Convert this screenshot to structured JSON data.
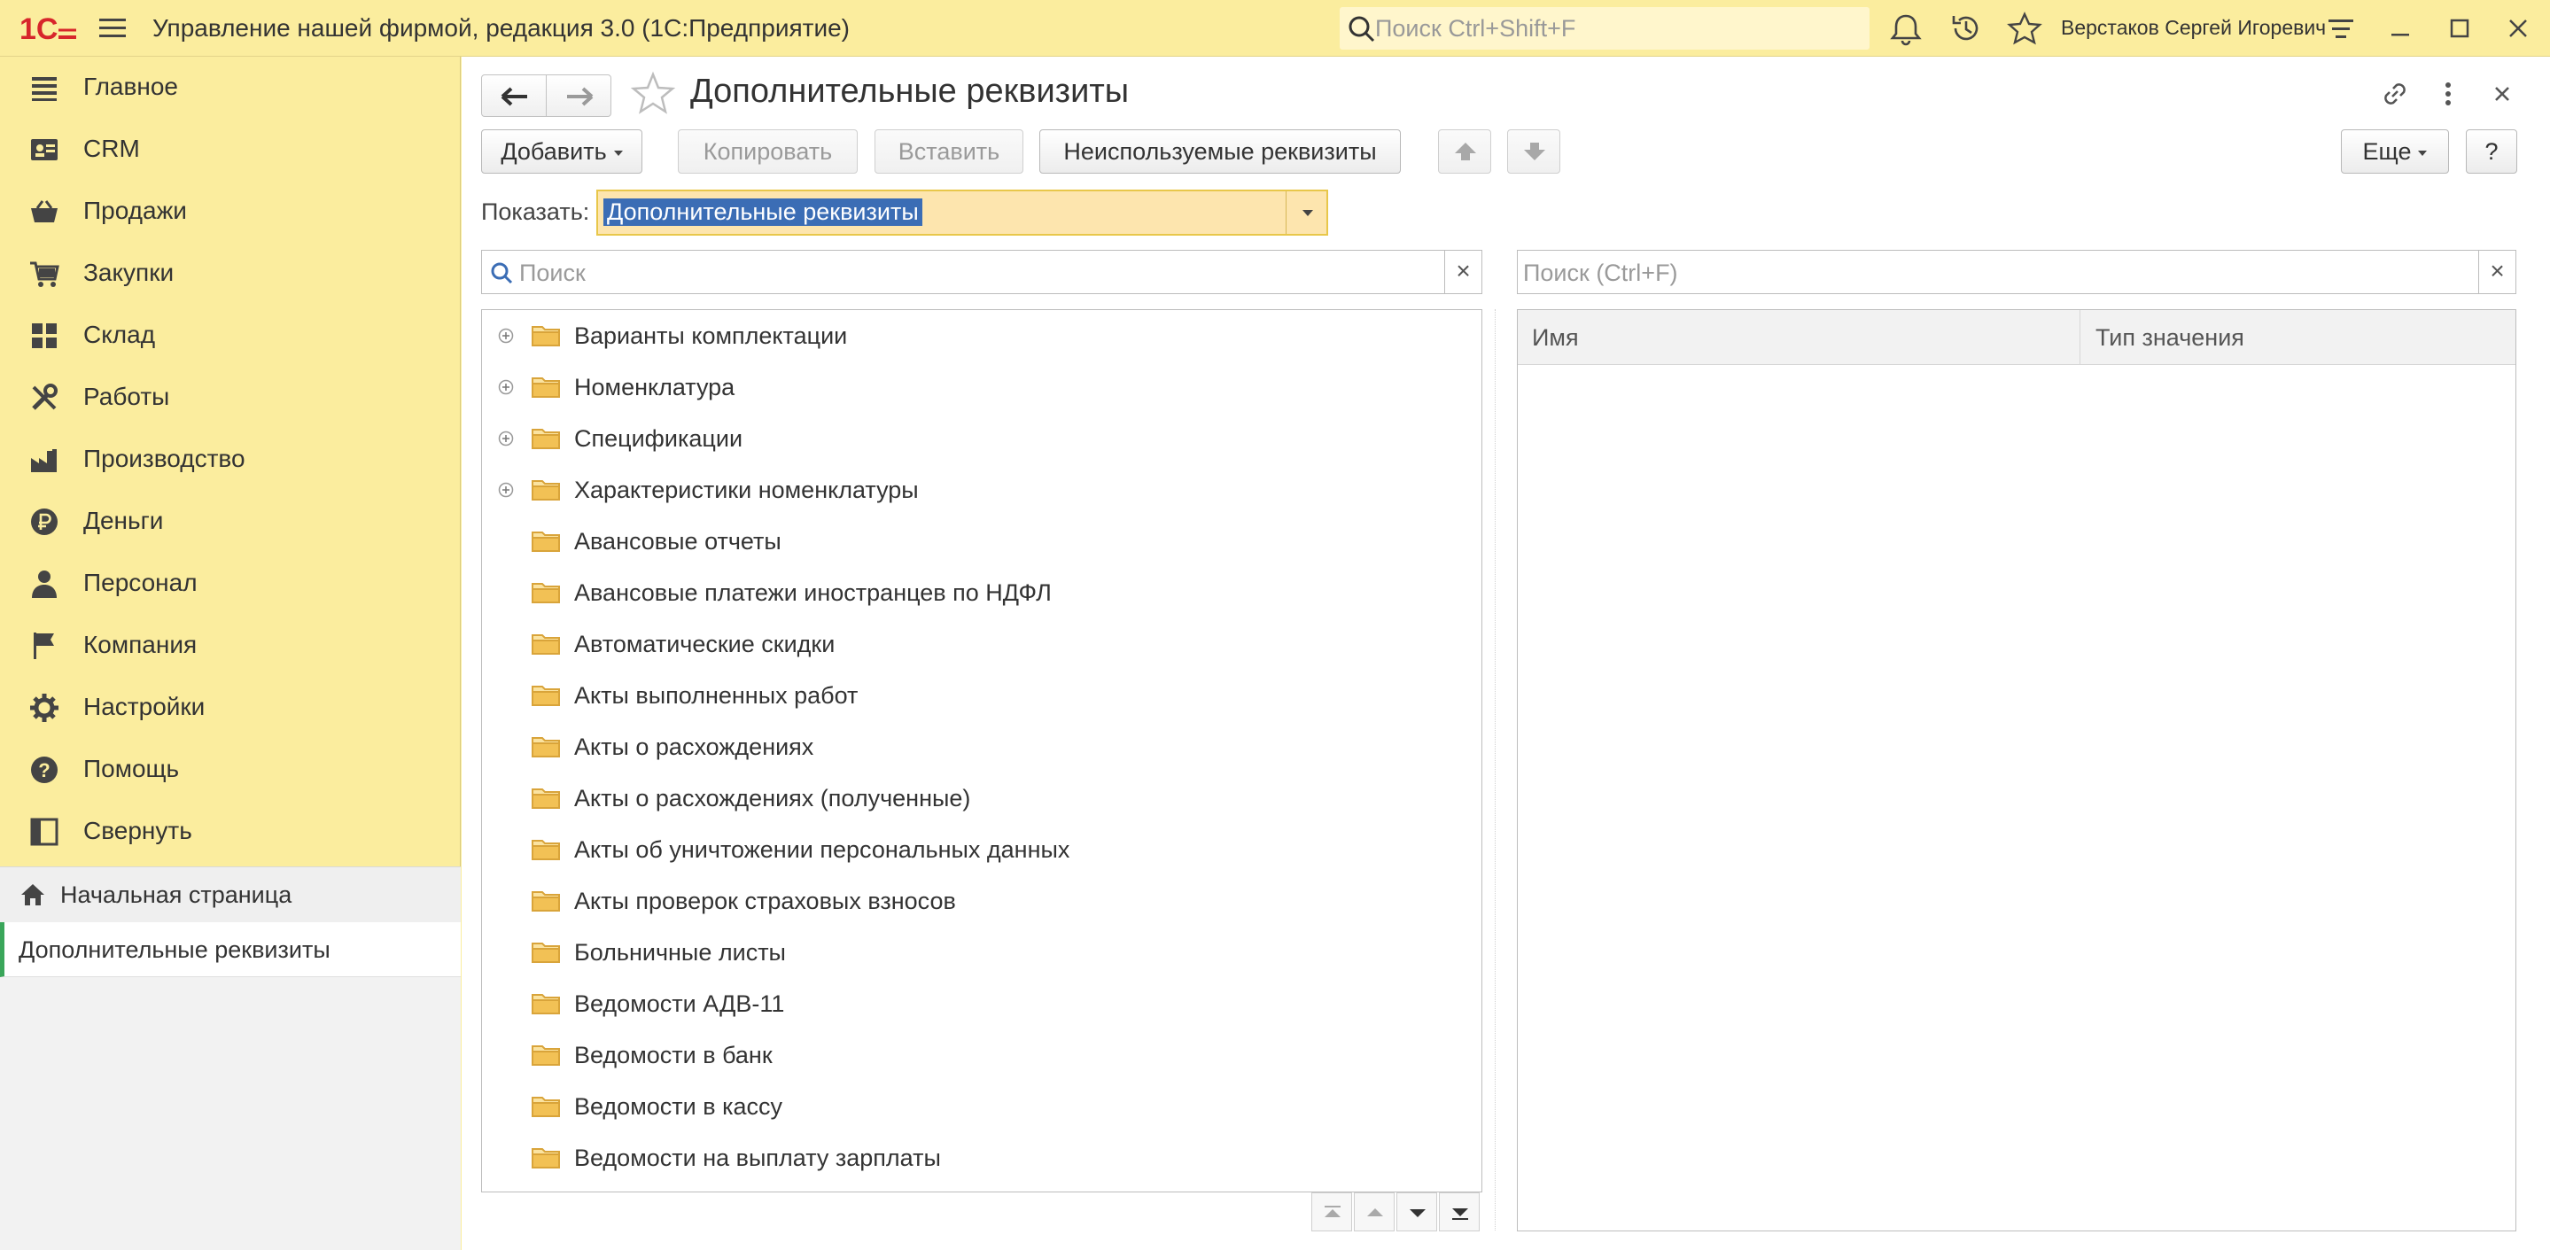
{
  "titlebar": {
    "app_title": "Управление нашей фирмой, редакция 3.0  (1С:Предприятие)",
    "search_placeholder": "Поиск Ctrl+Shift+F",
    "user_name": "Верстаков Сергей Игоревич"
  },
  "sidebar": {
    "items": [
      {
        "label": "Главное",
        "icon": "menu-lines-icon"
      },
      {
        "label": "CRM",
        "icon": "contacts-icon"
      },
      {
        "label": "Продажи",
        "icon": "basket-icon"
      },
      {
        "label": "Закупки",
        "icon": "cart-icon"
      },
      {
        "label": "Склад",
        "icon": "grid-icon"
      },
      {
        "label": "Работы",
        "icon": "tools-icon"
      },
      {
        "label": "Производство",
        "icon": "factory-icon"
      },
      {
        "label": "Деньги",
        "icon": "ruble-icon"
      },
      {
        "label": "Персонал",
        "icon": "person-icon"
      },
      {
        "label": "Компания",
        "icon": "flag-icon"
      },
      {
        "label": "Настройки",
        "icon": "gear-icon"
      },
      {
        "label": "Помощь",
        "icon": "help-icon"
      },
      {
        "label": "Свернуть",
        "icon": "collapse-icon"
      }
    ],
    "open_windows": {
      "home": "Начальная страница",
      "active": "Дополнительные реквизиты"
    }
  },
  "form": {
    "title": "Дополнительные реквизиты",
    "toolbar": {
      "add": "Добавить",
      "copy": "Копировать",
      "paste": "Вставить",
      "unused": "Неиспользуемые реквизиты",
      "more": "Еще",
      "help": "?"
    },
    "show_label": "Показать:",
    "show_value": "Дополнительные реквизиты",
    "left_search_placeholder": "Поиск",
    "right_search_placeholder": "Поиск (Ctrl+F)",
    "clear_symbol": "×",
    "tree": [
      {
        "label": "Варианты комплектации",
        "expandable": true
      },
      {
        "label": "Номенклатура",
        "expandable": true
      },
      {
        "label": "Спецификации",
        "expandable": true
      },
      {
        "label": "Характеристики номенклатуры",
        "expandable": true
      },
      {
        "label": "Авансовые отчеты",
        "expandable": false
      },
      {
        "label": "Авансовые платежи иностранцев по НДФЛ",
        "expandable": false
      },
      {
        "label": "Автоматические скидки",
        "expandable": false
      },
      {
        "label": "Акты выполненных работ",
        "expandable": false
      },
      {
        "label": "Акты о расхождениях",
        "expandable": false
      },
      {
        "label": "Акты о расхождениях (полученные)",
        "expandable": false
      },
      {
        "label": "Акты об уничтожении персональных данных",
        "expandable": false
      },
      {
        "label": "Акты проверок страховых взносов",
        "expandable": false
      },
      {
        "label": "Больничные листы",
        "expandable": false
      },
      {
        "label": "Ведомости АДВ-11",
        "expandable": false
      },
      {
        "label": "Ведомости в банк",
        "expandable": false
      },
      {
        "label": "Ведомости в кассу",
        "expandable": false
      },
      {
        "label": "Ведомости на выплату зарплаты",
        "expandable": false
      }
    ],
    "list_columns": [
      "Имя",
      "Тип значения"
    ]
  },
  "colors": {
    "panel_yellow": "#fbed9e",
    "active_green": "#3aa65a",
    "selection_blue": "#3b6db5",
    "folder_yellow": "#f2c155",
    "logo_red": "#d7262b"
  }
}
